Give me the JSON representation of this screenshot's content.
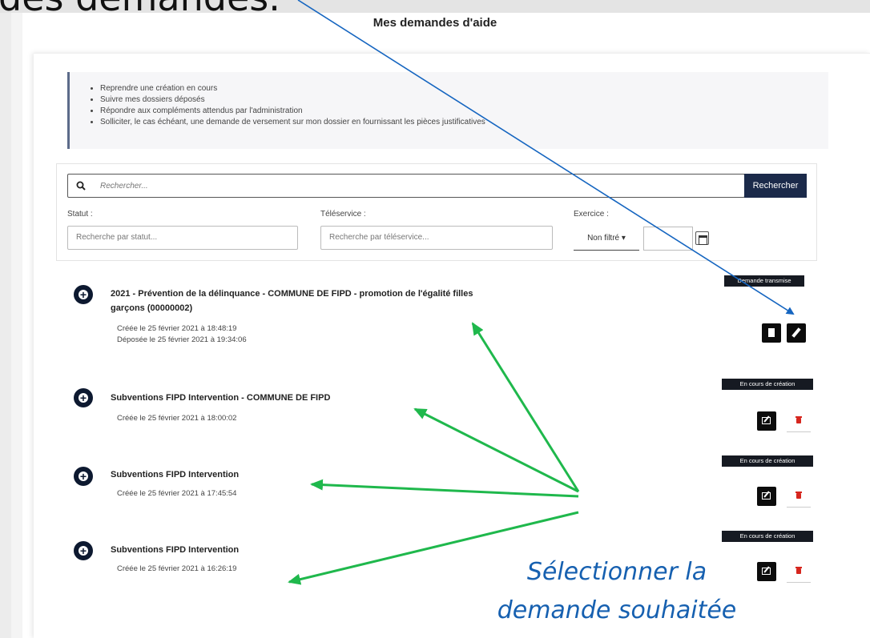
{
  "top_caption": "des demandes.",
  "page_title": "Mes demandes d'aide",
  "info_items": [
    "Reprendre une création en cours",
    "Suivre mes dossiers déposés",
    "Répondre aux compléments attendus par l'administration",
    "Solliciter, le cas échéant, une demande de versement sur mon dossier en fournissant les pièces justificatives"
  ],
  "search": {
    "placeholder": "Rechercher...",
    "button_label": "Rechercher"
  },
  "filters": {
    "status_label": "Statut :",
    "status_placeholder": "Recherche par statut...",
    "teleservice_label": "Téléservice :",
    "teleservice_placeholder": "Recherche par téléservice...",
    "year_label": "Exercice :",
    "year_value": "Non filtré"
  },
  "requests": [
    {
      "title_line1": "2021 - Prévention de la délinquance - COMMUNE DE FIPD - promotion de l'égalité filles",
      "title_line2": "garçons (00000002)",
      "created": "Créée le 25 février 2021 à 18:48:19",
      "submitted": "Déposée le 25 février 2021 à 19:34:06",
      "status": "Demande transmise",
      "actions": [
        "view-document-icon",
        "pencil-icon"
      ]
    },
    {
      "title_line1": "Subventions FIPD Intervention - COMMUNE DE FIPD",
      "created": "Créée le 25 février 2021 à 18:00:02",
      "status": "En cours de création",
      "actions": [
        "edit-icon",
        "trash-icon"
      ]
    },
    {
      "title_line1": "Subventions FIPD Intervention",
      "created": "Créée le 25 février 2021 à 17:45:54",
      "status": "En cours de création",
      "actions": [
        "edit-icon",
        "trash-icon"
      ]
    },
    {
      "title_line1": "Subventions FIPD Intervention",
      "created": "Créée le 25 février 2021 à 16:26:19",
      "status": "En cours de création",
      "actions": [
        "edit-icon",
        "trash-icon"
      ]
    }
  ],
  "callout_line1": "Sélectionner la",
  "callout_line2": "demande souhaitée",
  "colors": {
    "navy": "#1b2a4a",
    "arrow_blue": "#1565c0",
    "arrow_green": "#1fb84c",
    "callout_blue": "#1660b0",
    "trash_red": "#d6261e"
  }
}
